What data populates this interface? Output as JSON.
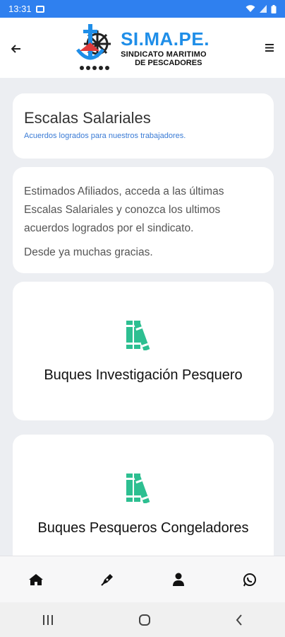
{
  "status_bar": {
    "time": "13:31",
    "icons": [
      "image-icon",
      "wifi-icon",
      "signal-icon",
      "battery-icon"
    ]
  },
  "header": {
    "back_icon": "arrow-left-icon",
    "menu_icon": "hamburger-menu-icon",
    "logo": {
      "brand": "SI.MA.PE.",
      "line1": "SINDICATO MARITIMO",
      "line2": "DE PESCADORES"
    }
  },
  "title_card": {
    "title": "Escalas Salariales",
    "subtitle": "Acuerdos logrados para nuestros trabajadores."
  },
  "message_card": {
    "paragraph1": "Estimados Afiliados, acceda a las últimas Escalas Salariales y conozca los ultimos acuerdos logrados por el sindicato.",
    "paragraph2": "Desde ya muchas gracias."
  },
  "tiles": [
    {
      "label": "Buques Investigación Pesquero",
      "icon": "books-icon"
    },
    {
      "label": "Buques Pesqueros Congeladores",
      "icon": "books-icon"
    }
  ],
  "bottom_nav": [
    "home-icon",
    "pen-icon",
    "user-icon",
    "whatsapp-icon"
  ],
  "system_nav": [
    "recents-icon",
    "home-circle-icon",
    "back-chevron-icon"
  ],
  "colors": {
    "status_bar": "#2f80ef",
    "accent_green": "#2dbf91",
    "brand_blue": "#1f8ee8",
    "subtitle_blue": "#3a7bd5"
  }
}
